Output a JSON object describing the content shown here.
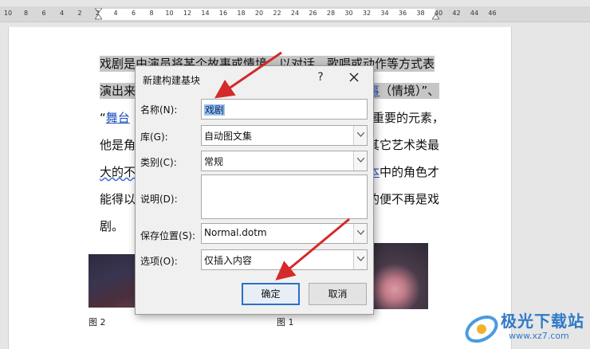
{
  "ruler": {
    "ticks": [
      "10",
      "8",
      "6",
      "4",
      "2",
      "2",
      "4",
      "6",
      "8",
      "10",
      "12",
      "14",
      "16",
      "18",
      "20",
      "22",
      "24",
      "26",
      "28",
      "30",
      "32",
      "34",
      "36",
      "38",
      "40",
      "42",
      "44",
      "46"
    ]
  },
  "document": {
    "lines": [
      "戏剧是由演员将某个故事或情境，以对话、歌唱或动作等方式表",
      "演出来",
      "“舞台",
      "他是角",
      "大的不",
      "能得以",
      "剧。"
    ],
    "line2_right": "（情境）”、",
    "line2_link": "事",
    "line3_link": "舞台",
    "line3_right": "重要的元素，",
    "line4_right": "其它艺术类最",
    "line5_right": "中的角色才",
    "line5_link": "本",
    "line6_right": "的便不再是戏",
    "captions": [
      "图 2",
      "图 1"
    ]
  },
  "dialog": {
    "title": "新建构建基块",
    "help": "?",
    "name_label": "名称(N):",
    "name_value": "戏剧",
    "gallery_label": "库(G):",
    "gallery_value": "自动图文集",
    "category_label": "类别(C):",
    "category_value": "常规",
    "description_label": "说明(D):",
    "description_value": "",
    "save_label": "保存位置(S):",
    "save_value": "Normal.dotm",
    "options_label": "选项(O):",
    "options_value": "仅插入内容",
    "ok_label": "确定",
    "cancel_label": "取消"
  },
  "watermark": {
    "text": "极光下载站",
    "sub": "www.xz7.com"
  },
  "colors": {
    "annotation_arrow": "#d42a2a",
    "selection": "#c6c6c6",
    "ok_border": "#2a6fc9"
  }
}
